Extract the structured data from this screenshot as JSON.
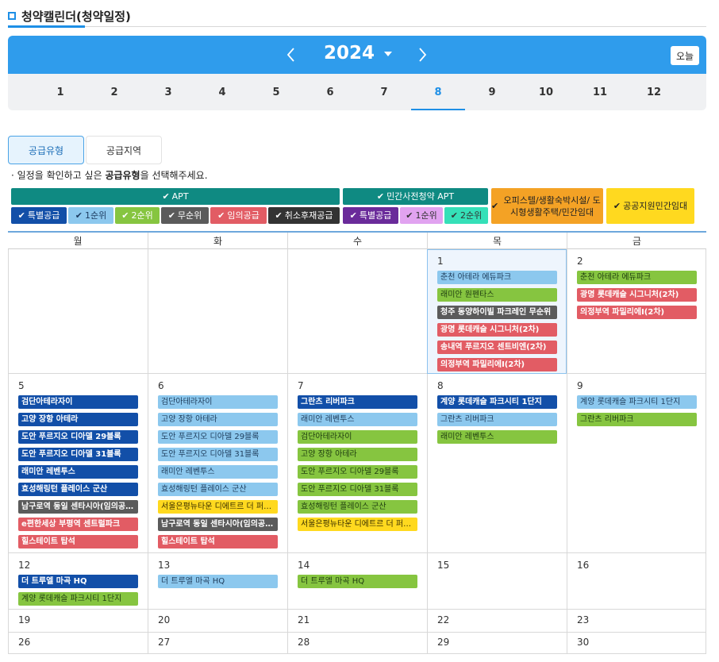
{
  "page": {
    "title": "청약캘린더(청약일정)"
  },
  "year_nav": {
    "year": "2024",
    "today_label": "오늘"
  },
  "months": [
    "1",
    "2",
    "3",
    "4",
    "5",
    "6",
    "7",
    "8",
    "9",
    "10",
    "11",
    "12"
  ],
  "active_month": "8",
  "tabs": [
    "공급유형",
    "공급지역"
  ],
  "hint": {
    "prefix": "· 일정을 확인하고 싶은 ",
    "bold": "공급유형",
    "suffix": "을 선택해주세요."
  },
  "legend": {
    "apt": "APT",
    "apt_items": [
      "특별공급",
      "1순위",
      "2순위",
      "무순위",
      "임의공급",
      "취소후재공급"
    ],
    "presale": "민간사전청약 APT",
    "presale_items": [
      "특별공급",
      "1순위",
      "2순위"
    ],
    "officetel": "오피스텔/생활숙박시설/ 도시형생활주택/민간임대",
    "public": "공공지원민간임대"
  },
  "weekdays": [
    "월",
    "화",
    "수",
    "목",
    "금"
  ],
  "weeks": [
    {
      "days": [
        {
          "date": "",
          "events": []
        },
        {
          "date": "",
          "events": []
        },
        {
          "date": "",
          "events": []
        },
        {
          "date": "1",
          "today": true,
          "events": [
            {
              "t": "춘천 아테라 에듀파크",
              "c": "first"
            },
            {
              "t": "래미안 원펜타스",
              "c": "second"
            },
            {
              "t": "청주 동양하이빌 파크레인 무순위",
              "c": "random"
            },
            {
              "t": "광명 롯데캐슬 시그니처(2차)",
              "c": "arbitrary"
            },
            {
              "t": "송내역 푸르지오 센트비엔(2차)",
              "c": "arbitrary"
            },
            {
              "t": "의정부역 파밀리에Ⅰ(2차)",
              "c": "arbitrary"
            }
          ]
        },
        {
          "date": "2",
          "events": [
            {
              "t": "춘천 아테라 에듀파크",
              "c": "second"
            },
            {
              "t": "광명 롯데캐슬 시그니처(2차)",
              "c": "arbitrary"
            },
            {
              "t": "의정부역 파밀리에Ⅰ(2차)",
              "c": "arbitrary"
            }
          ]
        }
      ]
    },
    {
      "days": [
        {
          "date": "5",
          "events": [
            {
              "t": "검단아테라자이",
              "c": "special"
            },
            {
              "t": "고양 장항 아테라",
              "c": "special"
            },
            {
              "t": "도안 푸르지오 디아델 29블록",
              "c": "special"
            },
            {
              "t": "도안 푸르지오 디아델 31블록",
              "c": "special"
            },
            {
              "t": "래미안 레벤투스",
              "c": "special"
            },
            {
              "t": "효성해링턴 플레이스 군산",
              "c": "special"
            },
            {
              "t": "남구로역 동일 센타시아(임의공급)",
              "c": "random"
            },
            {
              "t": "e편한세상 부평역 센트럴파크",
              "c": "arbitrary"
            },
            {
              "t": "힐스테이트 탑석",
              "c": "arbitrary"
            }
          ]
        },
        {
          "date": "6",
          "events": [
            {
              "t": "검단아테라자이",
              "c": "first"
            },
            {
              "t": "고양 장항 아테라",
              "c": "first"
            },
            {
              "t": "도안 푸르지오 디아델 29블록",
              "c": "first"
            },
            {
              "t": "도안 푸르지오 디아델 31블록",
              "c": "first"
            },
            {
              "t": "래미안 레벤투스",
              "c": "first"
            },
            {
              "t": "효성해링턴 플레이스 군산",
              "c": "first"
            },
            {
              "t": "서울은평뉴타운 디에트르 더 퍼스트",
              "c": "public"
            },
            {
              "t": "남구로역 동일 센타시아(임의공급)",
              "c": "random"
            },
            {
              "t": "힐스테이트 탑석",
              "c": "arbitrary"
            }
          ]
        },
        {
          "date": "7",
          "events": [
            {
              "t": "그란츠 리버파크",
              "c": "special"
            },
            {
              "t": "래미안 레벤투스",
              "c": "first"
            },
            {
              "t": "검단아테라자이",
              "c": "second"
            },
            {
              "t": "고양 장항 아테라",
              "c": "second"
            },
            {
              "t": "도안 푸르지오 디아델 29블록",
              "c": "second"
            },
            {
              "t": "도안 푸르지오 디아델 31블록",
              "c": "second"
            },
            {
              "t": "효성해링턴 플레이스 군산",
              "c": "second"
            },
            {
              "t": "서울은평뉴타운 디에트르 더 퍼스트",
              "c": "public"
            }
          ]
        },
        {
          "date": "8",
          "events": [
            {
              "t": "계양 롯데캐슬 파크시티 1단지",
              "c": "special"
            },
            {
              "t": "그란츠 리버파크",
              "c": "first"
            },
            {
              "t": "래미안 레벤투스",
              "c": "second"
            }
          ]
        },
        {
          "date": "9",
          "events": [
            {
              "t": "계양 롯데캐슬 파크시티 1단지",
              "c": "first"
            },
            {
              "t": "그란츠 리버파크",
              "c": "second"
            }
          ]
        }
      ]
    },
    {
      "days": [
        {
          "date": "12",
          "events": [
            {
              "t": "더 트루엘 마곡 HQ",
              "c": "special"
            },
            {
              "t": "계양 롯데캐슬 파크시티 1단지",
              "c": "second"
            }
          ]
        },
        {
          "date": "13",
          "events": [
            {
              "t": "더 트루엘 마곡 HQ",
              "c": "first"
            }
          ]
        },
        {
          "date": "14",
          "events": [
            {
              "t": "더 트루엘 마곡 HQ",
              "c": "second"
            }
          ]
        },
        {
          "date": "15",
          "events": []
        },
        {
          "date": "16",
          "events": []
        }
      ]
    },
    {
      "days": [
        {
          "date": "19",
          "events": []
        },
        {
          "date": "20",
          "events": []
        },
        {
          "date": "21",
          "events": []
        },
        {
          "date": "22",
          "events": []
        },
        {
          "date": "23",
          "events": []
        }
      ]
    },
    {
      "days": [
        {
          "date": "26",
          "events": []
        },
        {
          "date": "27",
          "events": []
        },
        {
          "date": "28",
          "events": []
        },
        {
          "date": "29",
          "events": []
        },
        {
          "date": "30",
          "events": []
        }
      ]
    }
  ],
  "colors": {
    "apt": "#0f8a82",
    "special": "#124fa8",
    "first": "#8cc8ee",
    "second": "#86c540",
    "random": "#5b5b5b",
    "arbitrary": "#e25c64",
    "cancel": "#333333",
    "presale_special": "#6a2b9a",
    "presale_first": "#e1a3f0",
    "presale_second": "#35e0b8",
    "officetel": "#f4a225",
    "public": "#ffd91f",
    "accent": "#2f9cec"
  }
}
